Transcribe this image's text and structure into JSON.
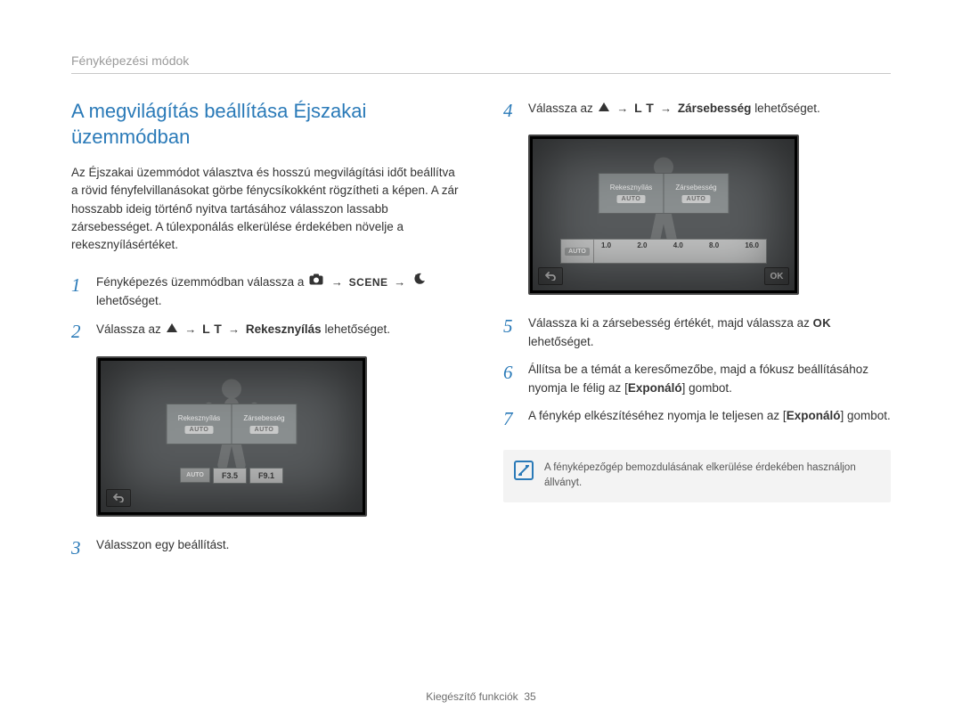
{
  "breadcrumb": "Fényképezési módok",
  "section_title": "A megvilágítás beállítása Éjszakai üzemmódban",
  "intro": "Az Éjszakai üzemmódot választva és hosszú megvilágítási időt beállítva a rövid fényfelvillanásokat görbe fénycsíkokként rögzítheti a képen. A zár hosszabb ideig történő nyitva tartásához válasszon lassabb zársebességet. A túlexponálás elkerülése érdekében növelje a rekesznyílásértéket.",
  "labels": {
    "scene": "SCENE",
    "lt": "L T",
    "ok": "OK",
    "auto": "AUTO"
  },
  "steps": {
    "1": {
      "pre": "Fényképezés üzemmódban válassza a ",
      "post": " lehetőséget."
    },
    "2": {
      "pre": "Válassza az ",
      "mid_bold": "Rekesznyílás",
      "post": " lehetőséget."
    },
    "3": "Válasszon egy beállítást.",
    "4": {
      "pre": "Válassza az ",
      "mid_bold": "Zársebesség",
      "post": " lehetőséget."
    },
    "5": {
      "pre": "Válassza ki a zársebesség értékét, majd válassza az ",
      "post": " lehetőséget."
    },
    "6": {
      "line": "Állítsa be a témát a keresőmezőbe, majd a fókusz beállításához nyomja le félig az ",
      "button": "Exponáló",
      "post": " gombot."
    },
    "7": {
      "line": "A fénykép elkészítéséhez nyomja le teljesen az ",
      "button": "Exponáló",
      "post": " gombot."
    }
  },
  "screen_tabs": {
    "aperture": "Rekesznyílás",
    "shutter": "Zársebesség"
  },
  "fstops": [
    "F3.5",
    "F9.1"
  ],
  "shutter_values": [
    "1.0",
    "2.0",
    "4.0",
    "8.0",
    "16.0"
  ],
  "note": "A fényképezőgép bemozdulásának elkerülése érdekében használjon állványt.",
  "footer": {
    "label": "Kiegészítő funkciók",
    "page": "35"
  }
}
